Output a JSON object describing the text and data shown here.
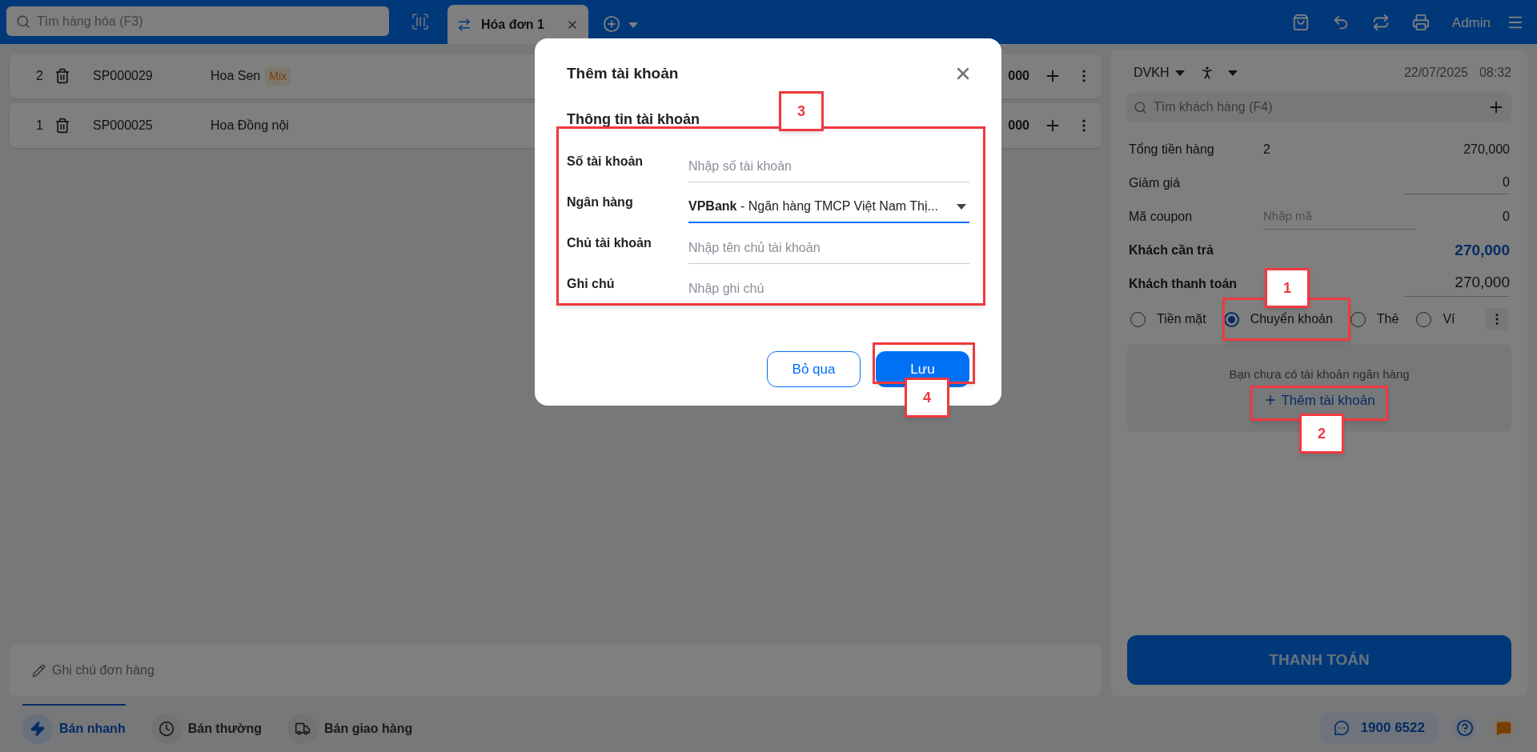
{
  "search": {
    "placeholder": "Tìm hàng hóa (F3)"
  },
  "tabs": [
    {
      "label": "Hóa đơn 1",
      "selected": true
    }
  ],
  "user": "Admin",
  "order_lines": [
    {
      "index": "2",
      "code": "SP000029",
      "name": "Hoa Sen",
      "tag": "Mix",
      "amount": "000"
    },
    {
      "index": "1",
      "code": "SP000025",
      "name": "Hoa Đồng nội",
      "amount": "000"
    }
  ],
  "order_note": {
    "placeholder": "Ghi chú đơn hàng"
  },
  "sale_modes": [
    {
      "label": "Bán nhanh",
      "selected": true
    },
    {
      "label": "Bán thường",
      "selected": false
    },
    {
      "label": "Bán giao hàng",
      "selected": false
    }
  ],
  "hotline": "1900 6522",
  "customer_panel": {
    "price_list": "DVKH",
    "date": "22/07/2025",
    "time": "08:32",
    "customer_search": {
      "placeholder": "Tìm khách hàng (F4)"
    },
    "summary": [
      {
        "kind": "plain",
        "label": "Tổng tiền hàng",
        "count": "2",
        "value": "270,000"
      },
      {
        "kind": "input",
        "label": "Giảm giá",
        "value": "0"
      },
      {
        "kind": "coupon",
        "label": "Mã coupon",
        "placeholder": "Nhập mã",
        "value": "0"
      },
      {
        "kind": "due",
        "label": "Khách cần trả",
        "value": "270,000"
      },
      {
        "kind": "input-bold",
        "label": "Khách thanh toán",
        "value": "270,000"
      }
    ],
    "payment_methods": [
      {
        "label": "Tiền mặt",
        "selected": false
      },
      {
        "label": "Chuyển khoản",
        "selected": true
      },
      {
        "label": "Thẻ",
        "selected": false
      },
      {
        "label": "Ví",
        "selected": false
      }
    ],
    "bank_notice": "Bạn chưa có tài khoản ngân hàng",
    "add_account_link": "Thêm tài khoản",
    "pay_button": "THANH TOÁN"
  },
  "dialog": {
    "title": "Thêm tài khoản",
    "section": "Thông tin tài khoản",
    "fields": [
      {
        "kind": "text",
        "label": "Số tài khoản",
        "placeholder": "Nhập số tài khoản",
        "focused": false
      },
      {
        "kind": "select",
        "label": "Ngân hàng",
        "value": "**VPBank** - Ngân hàng TMCP Việt Nam Thị...",
        "focused": true
      },
      {
        "kind": "text",
        "label": "Chủ tài khoản",
        "placeholder": "Nhập tên chủ tài khoản",
        "focused": false
      },
      {
        "kind": "text",
        "label": "Ghi chú",
        "placeholder": "Nhập ghi chú",
        "focused": false
      }
    ],
    "buttons": [
      {
        "kind": "secondary",
        "label": "Bỏ qua"
      },
      {
        "kind": "primary",
        "label": "Lưu"
      }
    ]
  },
  "annotations": [
    {
      "label": "1"
    },
    {
      "label": "2"
    },
    {
      "label": "3"
    },
    {
      "label": "4"
    }
  ]
}
